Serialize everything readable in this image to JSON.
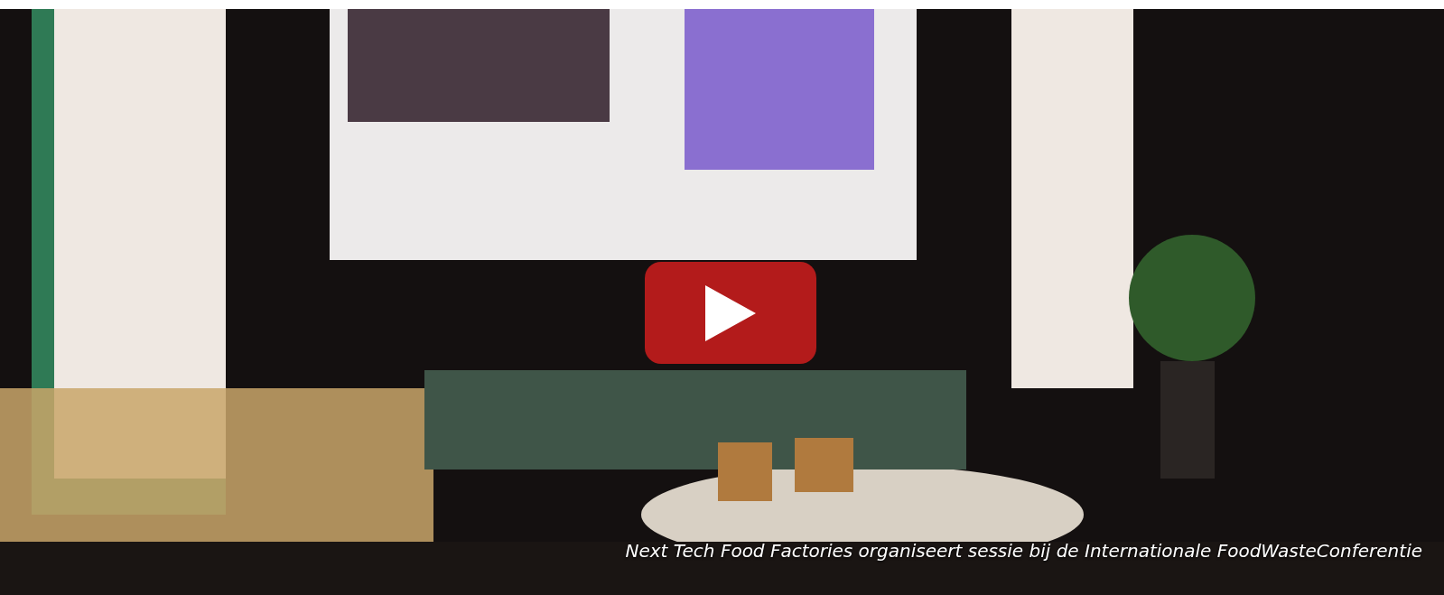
{
  "video": {
    "kind": "picture",
    "caption": "Next Tech Food Factories organiseert sessie bij de Internationale FoodWasteConferentie"
  }
}
